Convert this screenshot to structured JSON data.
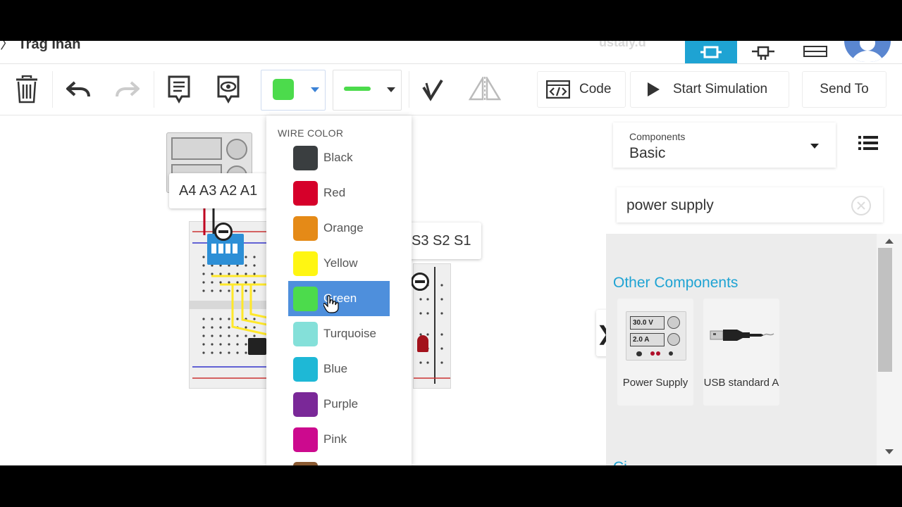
{
  "header": {
    "project_title": "Trag Inan",
    "faded_text": "ustaly.d"
  },
  "toolbar": {
    "code_label": "Code",
    "start_sim_label": "Start Simulation",
    "send_to_label": "Send To",
    "selected_wire_color": "#4cdb4c"
  },
  "canvas": {
    "pin_label_left": "A4 A3 A2 A1",
    "pin_label_right": "S3 S2 S1"
  },
  "wire_color_menu": {
    "heading": "WIRE COLOR",
    "items": [
      {
        "label": "Black",
        "color": "#3a3e40"
      },
      {
        "label": "Red",
        "color": "#d6002a"
      },
      {
        "label": "Orange",
        "color": "#e58a17"
      },
      {
        "label": "Yellow",
        "color": "#fff612"
      },
      {
        "label": "Green",
        "color": "#4cdb4c",
        "selected": true
      },
      {
        "label": "Turquoise",
        "color": "#84e0d9"
      },
      {
        "label": "Blue",
        "color": "#1eb8d6"
      },
      {
        "label": "Purple",
        "color": "#7a2898"
      },
      {
        "label": "Pink",
        "color": "#cc0a8e"
      }
    ]
  },
  "components_panel": {
    "selector_label": "Components",
    "selector_value": "Basic",
    "search_value": "power supply",
    "section_title": "Other Components",
    "items": [
      {
        "name": "Power Supply",
        "display_voltage": "30.0 V",
        "display_current": "2.0 A"
      },
      {
        "name": "USB standard A"
      }
    ],
    "next_section_partial": "Ci..."
  }
}
